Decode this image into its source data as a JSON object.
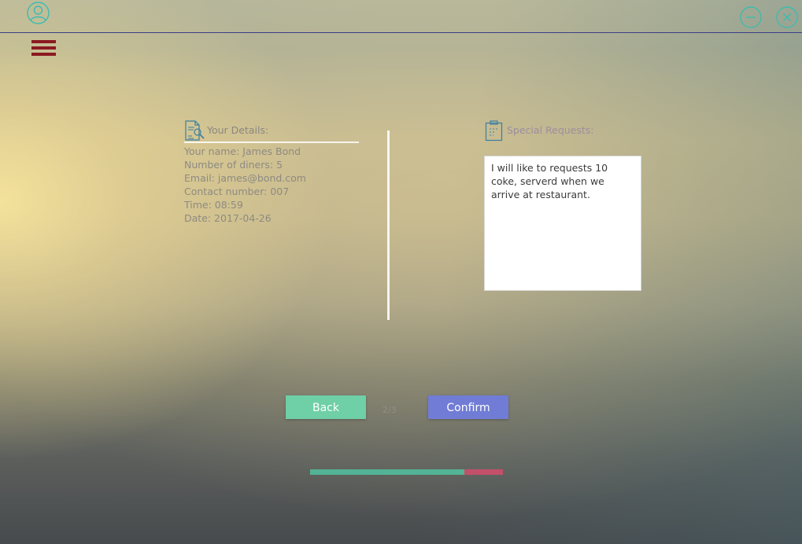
{
  "icons": {
    "user": "user-circle-icon",
    "minimize": "minimize-icon",
    "close": "close-icon",
    "menu": "hamburger-menu-icon",
    "details": "document-search-icon",
    "requests": "clipboard-icon"
  },
  "colors": {
    "accent_teal": "#3bbcb0",
    "menu_red": "#8b1a21",
    "topbar_line": "#3b3d86",
    "back_button": "#6fcfa6",
    "confirm_button": "#717cd6",
    "progress_done": "#53b395",
    "progress_remaining": "#c2506a"
  },
  "details": {
    "title": "Your Details:",
    "items": [
      "Your name: James Bond",
      "Number of diners: 5",
      "Email: james@bond.com",
      "Contact number: 007",
      "Time: 08:59",
      "Date: 2017-04-26"
    ]
  },
  "requests": {
    "title": "Special Requests:",
    "text": "I will like to requests 10 coke, serverd when we arrive at restaurant."
  },
  "navigation": {
    "back_label": "Back",
    "page_indicator": "2/3",
    "confirm_label": "Confirm"
  },
  "progress": {
    "fraction": 0.8
  }
}
